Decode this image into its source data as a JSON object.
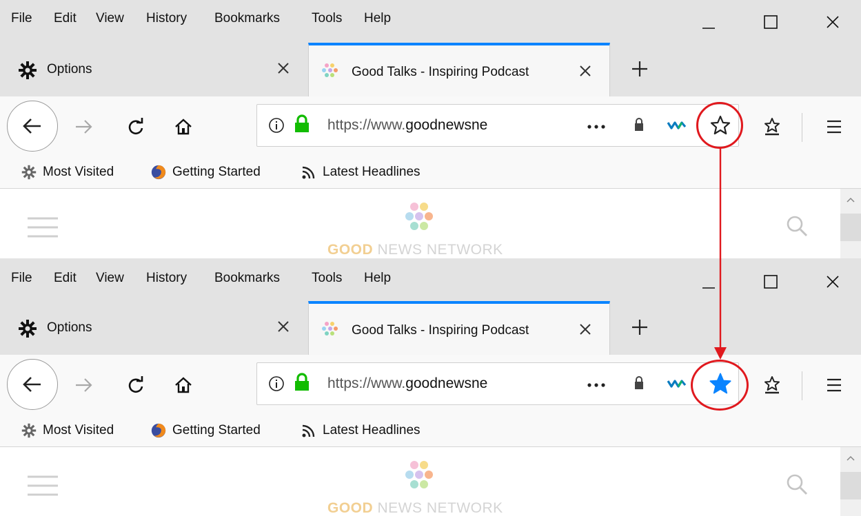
{
  "menu": {
    "file": "File",
    "edit": "Edit",
    "view": "View",
    "history": "History",
    "bookmarks": "Bookmarks",
    "tools": "Tools",
    "help": "Help"
  },
  "tabs": [
    {
      "label": "Options",
      "icon": "gear-icon"
    },
    {
      "label": "Good Talks - Inspiring Podcast",
      "icon": "colorful-dots-icon",
      "active": true
    }
  ],
  "url": {
    "prefix": "https://www.",
    "domain": "goodnewsne"
  },
  "bookmarks_toolbar": [
    {
      "label": "Most Visited",
      "icon": "gear-icon"
    },
    {
      "label": "Getting Started",
      "icon": "firefox-icon"
    },
    {
      "label": "Latest Headlines",
      "icon": "rss-icon"
    }
  ],
  "page": {
    "logo": "GOOD NEWS NETWORK",
    "logo_bold": "GOOD",
    "logo_rest": " NEWS NETWORK"
  },
  "states": {
    "top": {
      "star_filled": false
    },
    "bottom": {
      "star_filled": true
    }
  },
  "colors": {
    "accent": "#0a84ff",
    "annotation": "#e0191e",
    "lock": "#12bc00",
    "star_filled": "#0a84ff"
  }
}
